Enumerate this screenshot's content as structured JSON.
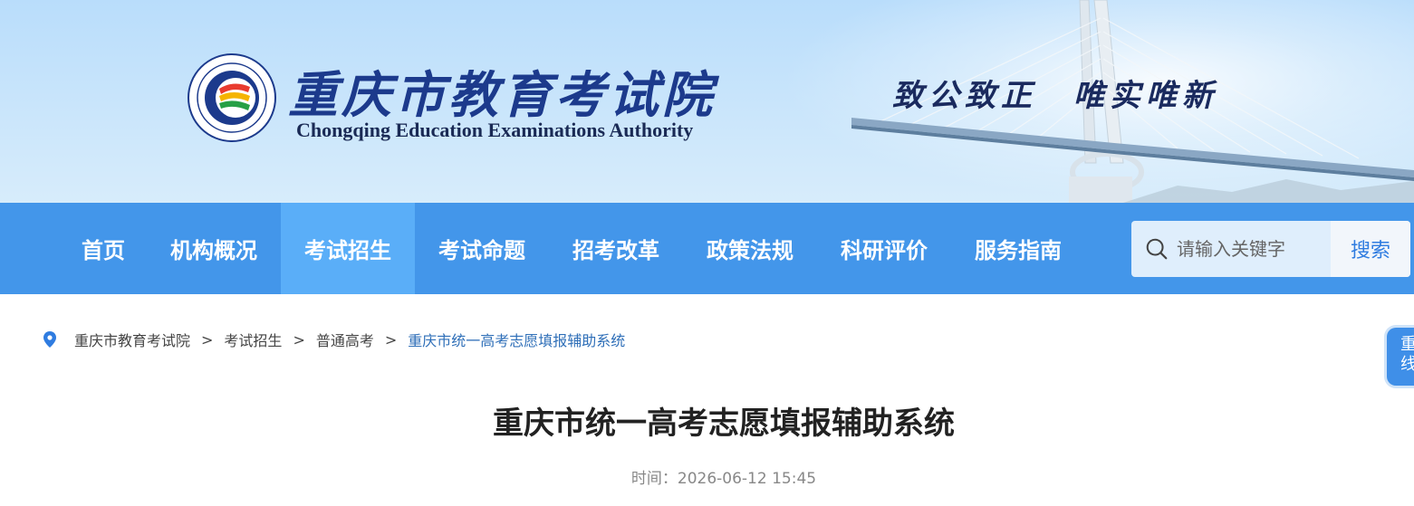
{
  "header": {
    "cn_title": "重庆市教育考试院",
    "en_title": "Chongqing Education Examinations Authority",
    "motto": "致公致正　唯实唯新",
    "logo_icon": "authority-seal-icon",
    "logo_ring_text": "Chongqing Education Examinations Authority",
    "logo_bottom_text": "重庆市教育考试院"
  },
  "nav": {
    "items": [
      {
        "label": "首页"
      },
      {
        "label": "机构概况"
      },
      {
        "label": "考试招生"
      },
      {
        "label": "考试命题"
      },
      {
        "label": "招考改革"
      },
      {
        "label": "政策法规"
      },
      {
        "label": "科研评价"
      },
      {
        "label": "服务指南"
      }
    ],
    "active": "考试招生"
  },
  "search": {
    "placeholder": "请输入关键字",
    "value": "",
    "button": "搜索"
  },
  "breadcrumb": {
    "items": [
      "重庆市教育考试院",
      "考试招生",
      "普通高考",
      "重庆市统一高考志愿填报辅助系统"
    ],
    "separator": ">"
  },
  "article": {
    "title": "重庆市统一高考志愿填报辅助系统",
    "meta": "时间：2026-06-12 15:45"
  },
  "side_float": {
    "label_line1": "重",
    "label_line2": "线"
  },
  "colors": {
    "nav_bg": "#4396ea",
    "nav_active": "#5aaef8",
    "breadcrumb_current": "#2f6fb8",
    "title": "#222222"
  }
}
